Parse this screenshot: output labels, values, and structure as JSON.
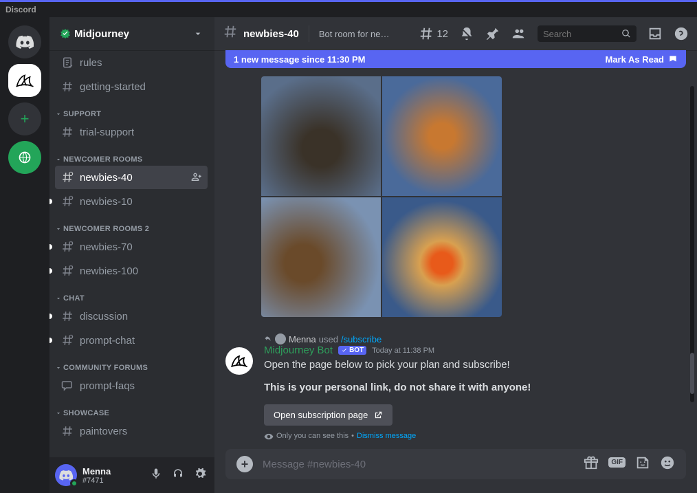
{
  "titlebar": "Discord",
  "server": {
    "name": "Midjourney"
  },
  "categories": [
    {
      "name": "",
      "channels": [
        {
          "label": "rules",
          "type": "rules"
        },
        {
          "label": "getting-started",
          "type": "text"
        }
      ]
    },
    {
      "name": "SUPPORT",
      "channels": [
        {
          "label": "trial-support",
          "type": "text"
        }
      ]
    },
    {
      "name": "NEWCOMER ROOMS",
      "channels": [
        {
          "label": "newbies-40",
          "type": "locked",
          "active": true
        },
        {
          "label": "newbies-10",
          "type": "locked",
          "unread": true
        }
      ]
    },
    {
      "name": "NEWCOMER ROOMS 2",
      "channels": [
        {
          "label": "newbies-70",
          "type": "locked",
          "unread": true
        },
        {
          "label": "newbies-100",
          "type": "locked",
          "unread": true
        }
      ]
    },
    {
      "name": "CHAT",
      "channels": [
        {
          "label": "discussion",
          "type": "text",
          "unread": true
        },
        {
          "label": "prompt-chat",
          "type": "locked",
          "unread": true
        }
      ]
    },
    {
      "name": "COMMUNITY FORUMS",
      "channels": [
        {
          "label": "prompt-faqs",
          "type": "forum"
        }
      ]
    },
    {
      "name": "SHOWCASE",
      "channels": [
        {
          "label": "paintovers",
          "type": "text"
        }
      ]
    }
  ],
  "user": {
    "name": "Menna",
    "tag": "#7471"
  },
  "header": {
    "channel": "newbies-40",
    "topic": "Bot room for ne…",
    "threads": "12",
    "search_placeholder": "Search"
  },
  "banner": {
    "text": "1 new message since 11:30 PM",
    "action": "Mark As Read"
  },
  "sys": {
    "user": "Menna",
    "verb": "used",
    "command": "/subscribe"
  },
  "bot": {
    "name": "Midjourney Bot",
    "tag": "BOT",
    "time": "Today at 11:38 PM",
    "line1": "Open the page below to pick your plan and subscribe!",
    "line2": "This is your personal link, do not share it with anyone!",
    "button": "Open subscription page",
    "ephemeral": "Only you can see this",
    "dismiss": "Dismiss message"
  },
  "composer": {
    "placeholder": "Message #newbies-40"
  }
}
